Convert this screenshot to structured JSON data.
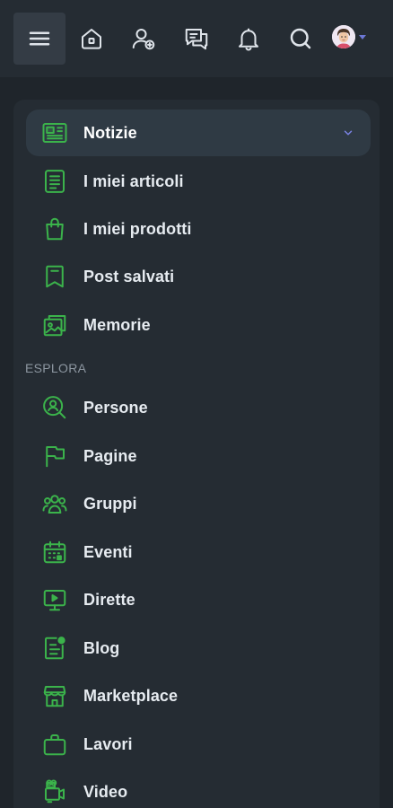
{
  "topbar": {
    "icons": [
      "menu-icon",
      "home-icon",
      "add-friend-icon",
      "messages-icon",
      "notifications-icon",
      "search-icon",
      "avatar",
      "caret-down-icon"
    ]
  },
  "menu": {
    "items": [
      {
        "label": "Notizie",
        "icon": "news-icon",
        "active": true
      },
      {
        "label": "I miei articoli",
        "icon": "articles-icon"
      },
      {
        "label": "I miei prodotti",
        "icon": "products-icon"
      },
      {
        "label": "Post salvati",
        "icon": "bookmark-icon"
      },
      {
        "label": "Memorie",
        "icon": "memories-icon"
      }
    ],
    "section_label": "ESPLORA",
    "explore": [
      {
        "label": "Persone",
        "icon": "people-search-icon"
      },
      {
        "label": "Pagine",
        "icon": "flag-icon"
      },
      {
        "label": "Gruppi",
        "icon": "groups-icon"
      },
      {
        "label": "Eventi",
        "icon": "calendar-icon"
      },
      {
        "label": "Dirette",
        "icon": "live-icon"
      },
      {
        "label": "Blog",
        "icon": "blog-icon"
      },
      {
        "label": "Marketplace",
        "icon": "store-icon"
      },
      {
        "label": "Lavori",
        "icon": "briefcase-icon"
      },
      {
        "label": "Video",
        "icon": "video-icon"
      }
    ]
  },
  "colors": {
    "accent": "#3bb34b",
    "background": "#1f252b",
    "panel": "#252c33",
    "chevron": "#7b83e6"
  }
}
